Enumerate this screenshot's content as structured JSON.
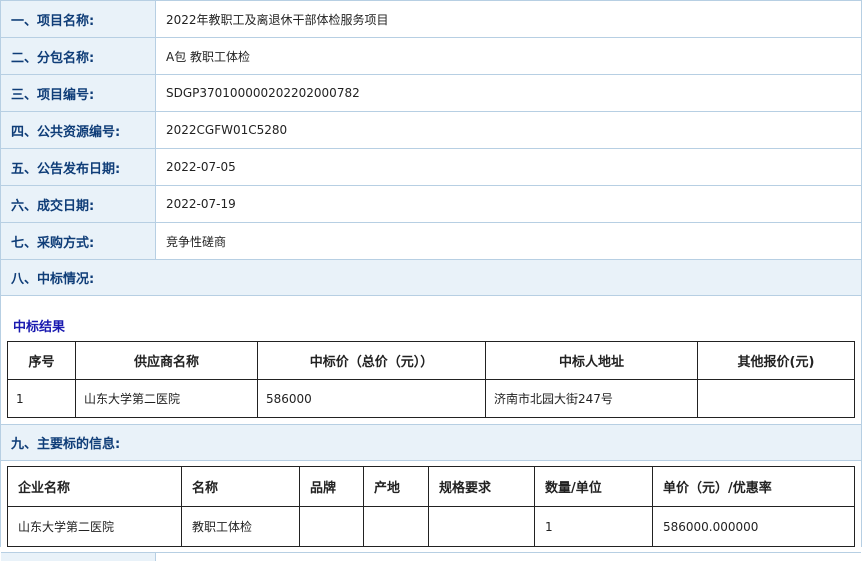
{
  "rows": [
    {
      "label": "一、项目名称:",
      "value": "2022年教职工及离退休干部体检服务项目"
    },
    {
      "label": "二、分包名称:",
      "value": "A包 教职工体检"
    },
    {
      "label": "三、项目编号:",
      "value": "SDGP370100000202202000782"
    },
    {
      "label": "四、公共资源编号:",
      "value": "2022CGFW01C5280"
    },
    {
      "label": "五、公告发布日期:",
      "value": "2022-07-05"
    },
    {
      "label": "六、成交日期:",
      "value": "2022-07-19"
    },
    {
      "label": "七、采购方式:",
      "value": "竞争性磋商"
    }
  ],
  "section8": {
    "title": "八、中标情况:",
    "subtitle": "中标结果",
    "headers": [
      "序号",
      "供应商名称",
      "中标价（总价（元））",
      "中标人地址",
      "其他报价(元)"
    ],
    "row": [
      "1",
      "山东大学第二医院",
      "586000",
      "济南市北园大街247号",
      ""
    ]
  },
  "section9": {
    "title": "九、主要标的信息:",
    "headers": [
      "企业名称",
      "名称",
      "品牌",
      "产地",
      "规格要求",
      "数量/单位",
      "单价（元）/优惠率"
    ],
    "row": [
      "山东大学第二医院",
      "教职工体检",
      "",
      "",
      "",
      "1",
      "586000.000000"
    ]
  }
}
